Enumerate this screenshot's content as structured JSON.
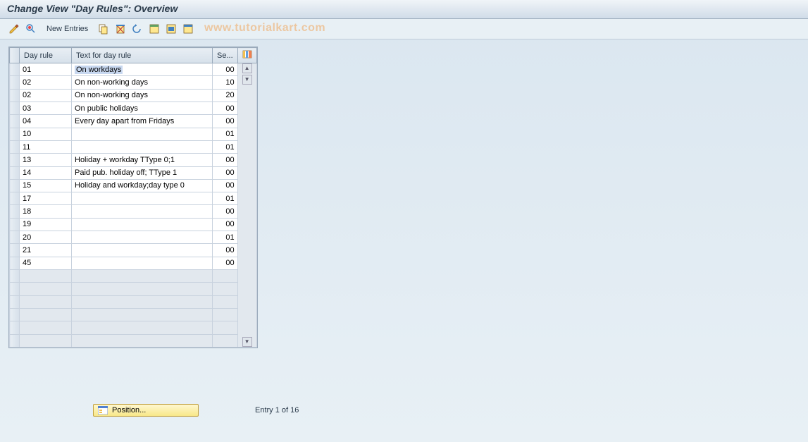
{
  "title": "Change View \"Day Rules\": Overview",
  "watermark": "www.tutorialkart.com",
  "toolbar": {
    "new_entries_label": "New Entries"
  },
  "columns": {
    "day_rule": "Day rule",
    "text": "Text for day rule",
    "seq": "Se..."
  },
  "rows": [
    {
      "day_rule": "01",
      "text": "On workdays",
      "seq": "00",
      "selected": true
    },
    {
      "day_rule": "02",
      "text": "On non-working days",
      "seq": "10"
    },
    {
      "day_rule": "02",
      "text": "On non-working days",
      "seq": "20"
    },
    {
      "day_rule": "03",
      "text": "On public holidays",
      "seq": "00"
    },
    {
      "day_rule": "04",
      "text": "Every day apart from Fridays",
      "seq": "00"
    },
    {
      "day_rule": "10",
      "text": "",
      "seq": "01"
    },
    {
      "day_rule": "11",
      "text": "",
      "seq": "01"
    },
    {
      "day_rule": "13",
      "text": "Holiday + workday TType 0;1",
      "seq": "00"
    },
    {
      "day_rule": "14",
      "text": "Paid pub. holiday off; TType 1",
      "seq": "00"
    },
    {
      "day_rule": "15",
      "text": "Holiday and workday;day type 0",
      "seq": "00"
    },
    {
      "day_rule": "17",
      "text": "",
      "seq": "01"
    },
    {
      "day_rule": "18",
      "text": "",
      "seq": "00"
    },
    {
      "day_rule": "19",
      "text": "",
      "seq": "00"
    },
    {
      "day_rule": "20",
      "text": "",
      "seq": "01"
    },
    {
      "day_rule": "21",
      "text": "",
      "seq": "00"
    },
    {
      "day_rule": "45",
      "text": "",
      "seq": "00"
    }
  ],
  "empty_rows": 6,
  "footer": {
    "position_label": "Position...",
    "entry_text": "Entry 1 of 16"
  }
}
